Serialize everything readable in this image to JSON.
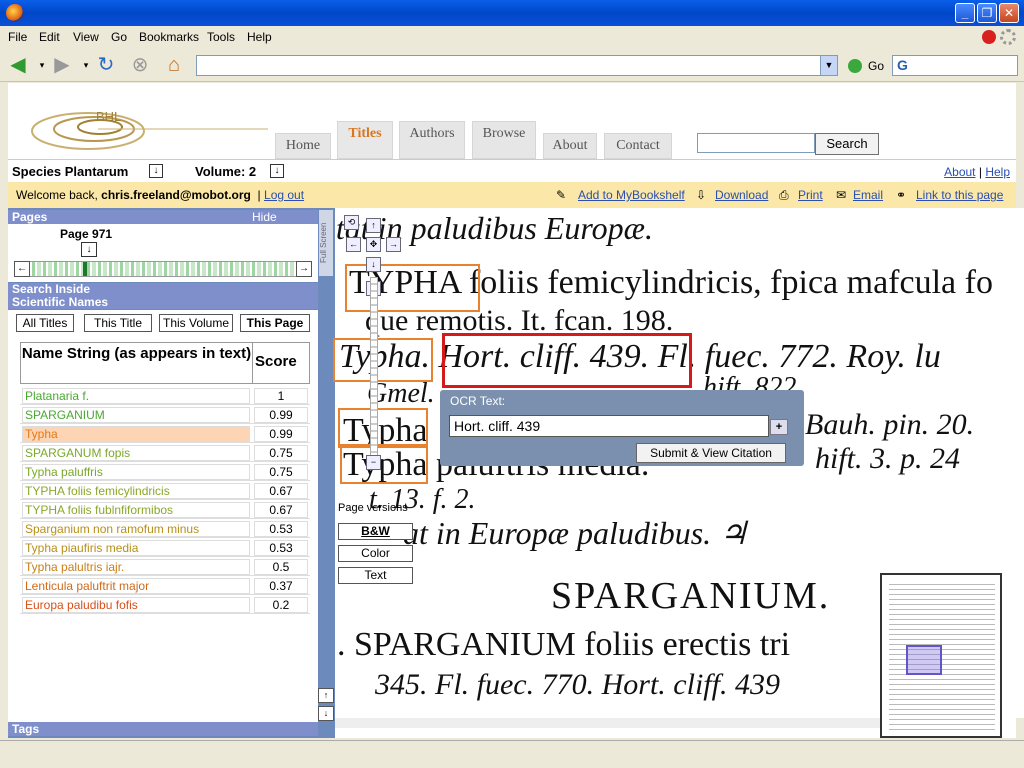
{
  "browser": {
    "menu": [
      "File",
      "Edit",
      "View",
      "Go",
      "Bookmarks",
      "Tools",
      "Help"
    ],
    "go_label": "Go",
    "window_buttons": [
      "_",
      "❐",
      "✕"
    ]
  },
  "header": {
    "logo_text": "BHL",
    "tabs": [
      "Home",
      "Titles",
      "Authors",
      "Browse",
      "About",
      "Contact"
    ],
    "search_button": "Search"
  },
  "book": {
    "title": "Species Plantarum",
    "volume": "Volume: 2",
    "about": "About",
    "sep": "|",
    "help": "Help"
  },
  "welcome": {
    "prefix": "Welcome back,",
    "user": "chris.freeland@mobot.org",
    "bar": "|",
    "logout": "Log out",
    "tools": [
      "Add to MyBookshelf",
      "Download",
      "Print",
      "Email",
      "Link to this page"
    ]
  },
  "left": {
    "pages_label": "Pages",
    "hide_label": "Hide",
    "page_label": "Page 971",
    "search_inside": "Search Inside",
    "scientific_names": "Scientific Names",
    "filters": [
      "All Titles",
      "This Title",
      "This Volume",
      "This Page"
    ],
    "col_name": "Name String (as appears in text)",
    "col_score": "Score",
    "rows": [
      {
        "name": "Platanaria f.",
        "score": "1",
        "color": "#4aa832"
      },
      {
        "name": "SPARGANIUM",
        "score": "0.99",
        "color": "#4aa832"
      },
      {
        "name": "Typha",
        "score": "0.99",
        "color": "#e07b1a"
      },
      {
        "name": "SPARGANUM fopis",
        "score": "0.75",
        "color": "#7aa82a"
      },
      {
        "name": "Typha paluffris",
        "score": "0.75",
        "color": "#7aa82a"
      },
      {
        "name": "TYPHA foliis femicylindricis",
        "score": "0.67",
        "color": "#8aa82a"
      },
      {
        "name": "TYPHA foliis fublnfiformibos",
        "score": "0.67",
        "color": "#8aa82a"
      },
      {
        "name": "Sparganium non ramofum minus",
        "score": "0.53",
        "color": "#b8901a"
      },
      {
        "name": "Typha piaufiris media",
        "score": "0.53",
        "color": "#b8901a"
      },
      {
        "name": "Typha palultris iajr.",
        "score": "0.5",
        "color": "#c8801a"
      },
      {
        "name": "Lenticula paluftrit major",
        "score": "0.37",
        "color": "#d06a1a"
      },
      {
        "name": "Europa paludibu fofis",
        "score": "0.2",
        "color": "#d8501a"
      }
    ],
    "tags": "Tags"
  },
  "viewer": {
    "full_screen": "Full Screen",
    "lines": [
      "itat in paludibus Europæ.",
      "TYPHA foliis femicylindricis, fpica mafcula fo",
      "que remotis. It. fcan. 198.",
      "Typha.   Hort. cliff. 439.  Fl. fuec. 772. Roy. lu",
      "Gmel.",
      "hift. 822.",
      "Typha",
      "Bauh. pin. 20.",
      "Typha    paluftris media.",
      "hift. 3.   p. 24",
      "t. 13. f. 2.",
      "at in Europæ paludibus.  ♃",
      "SPARGANIUM.",
      ". SPARGANIUM foliis erectis tri",
      "345. Fl. fuec. 770. Hort. cliff. 439"
    ],
    "ocr_label": "OCR Text:",
    "ocr_value": "Hort. cliff. 439",
    "ocr_plus": "+",
    "submit": "Submit & View Citation",
    "page_versions": "Page versions",
    "versions": [
      "B&W",
      "Color",
      "Text"
    ]
  }
}
